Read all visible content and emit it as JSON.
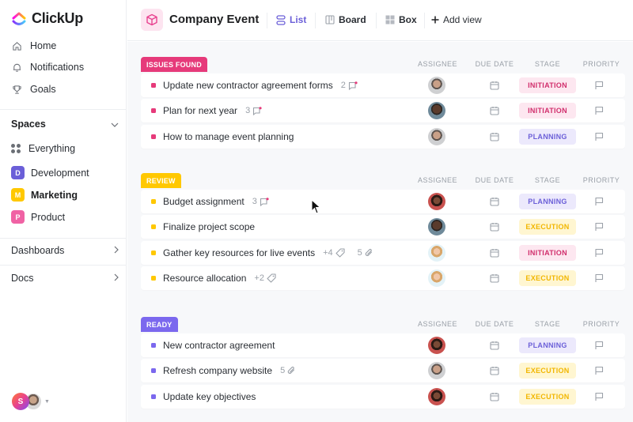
{
  "app": {
    "name": "ClickUp"
  },
  "sidebar": {
    "nav": [
      {
        "label": "Home",
        "icon": "home-icon"
      },
      {
        "label": "Notifications",
        "icon": "bell-icon"
      },
      {
        "label": "Goals",
        "icon": "trophy-icon"
      }
    ],
    "spaces_label": "Spaces",
    "everything_label": "Everything",
    "spaces": [
      {
        "letter": "D",
        "label": "Development",
        "color": "#6b5fd8"
      },
      {
        "letter": "M",
        "label": "Marketing",
        "color": "#ffc800",
        "active": true
      },
      {
        "letter": "P",
        "label": "Product",
        "color": "#f062a4"
      }
    ],
    "dashboards_label": "Dashboards",
    "docs_label": "Docs",
    "user_initial": "S"
  },
  "header": {
    "title": "Company Event",
    "views": [
      {
        "label": "List",
        "icon": "list-icon",
        "active": true
      },
      {
        "label": "Board",
        "icon": "board-icon"
      },
      {
        "label": "Box",
        "icon": "box-icon"
      }
    ],
    "add_view_label": "Add view"
  },
  "columns": {
    "assignee": "ASSIGNEE",
    "due_date": "DUE DATE",
    "stage": "STAGE",
    "priority": "PRIORITY"
  },
  "stages": {
    "INITIATION": {
      "bg": "#fde7f0",
      "fg": "#d12e6c"
    },
    "PLANNING": {
      "bg": "#ece9fc",
      "fg": "#6b5fd8"
    },
    "EXECUTION": {
      "bg": "#fff6d1",
      "fg": "#f2b600"
    }
  },
  "groups": [
    {
      "label": "ISSUES FOUND",
      "color": "#e63a7a",
      "tasks": [
        {
          "name": "Update new contractor agreement forms",
          "comments": "2",
          "stage": "INITIATION",
          "assignee": "man-gray"
        },
        {
          "name": "Plan for next year",
          "comments": "3",
          "stage": "INITIATION",
          "assignee": "man-dark"
        },
        {
          "name": "How to manage event planning",
          "stage": "PLANNING",
          "assignee": "man-gray"
        }
      ]
    },
    {
      "label": "REVIEW",
      "color": "#ffc800",
      "tasks": [
        {
          "name": "Budget assignment",
          "comments": "3",
          "stage": "PLANNING",
          "assignee": "woman-dark"
        },
        {
          "name": "Finalize project scope",
          "stage": "EXECUTION",
          "assignee": "man-dark"
        },
        {
          "name": "Gather key resources for live events",
          "tags": "+4",
          "attachments": "5",
          "stage": "INITIATION",
          "assignee": "woman-blonde"
        },
        {
          "name": "Resource allocation",
          "tags": "+2",
          "stage": "EXECUTION",
          "assignee": "woman-blonde"
        }
      ]
    },
    {
      "label": "READY",
      "color": "#7b68ee",
      "tasks": [
        {
          "name": "New contractor agreement",
          "stage": "PLANNING",
          "assignee": "woman-dark"
        },
        {
          "name": "Refresh company website",
          "attachments": "5",
          "stage": "EXECUTION",
          "assignee": "man-gray"
        },
        {
          "name": "Update key objectives",
          "stage": "EXECUTION",
          "assignee": "woman-dark"
        }
      ]
    }
  ]
}
